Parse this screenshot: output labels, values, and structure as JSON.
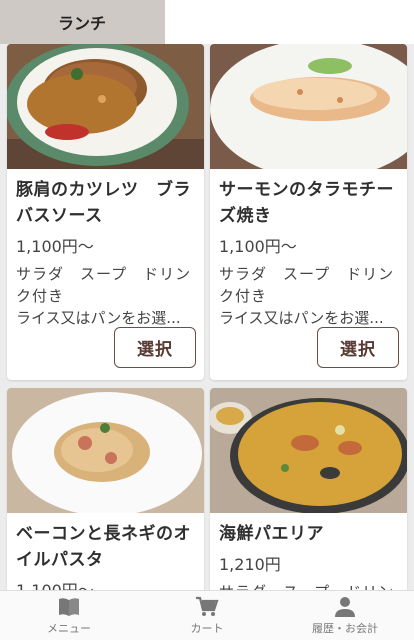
{
  "header": {
    "tab_label": "ランチ"
  },
  "menu_items": [
    {
      "name": "豚肩のカツレツ　ブラバスソース",
      "price": "1,100円〜",
      "desc": "サラダ　スープ　ドリンク付き",
      "desc2": "ライス又はパンをお選...",
      "button": "選択"
    },
    {
      "name": "サーモンのタラモチーズ焼き",
      "price": "1,100円〜",
      "desc": "サラダ　スープ　ドリンク付き",
      "desc2": "ライス又はパンをお選...",
      "button": "選択"
    },
    {
      "name": "ベーコンと長ネギのオイルパスタ",
      "price": "1,100円〜",
      "desc": "",
      "desc2": "",
      "button": ""
    },
    {
      "name": "海鮮パエリア",
      "price": "1,210円",
      "desc": "サラダ　スープ　ドリン",
      "desc2": "",
      "button": ""
    }
  ],
  "bottom_nav": {
    "menu_label": "メニュー",
    "cart_label": "カート",
    "history_label": "履歴・お会計"
  },
  "colors": {
    "accent": "#6b4e45",
    "header_tab": "#cfc9c5"
  }
}
